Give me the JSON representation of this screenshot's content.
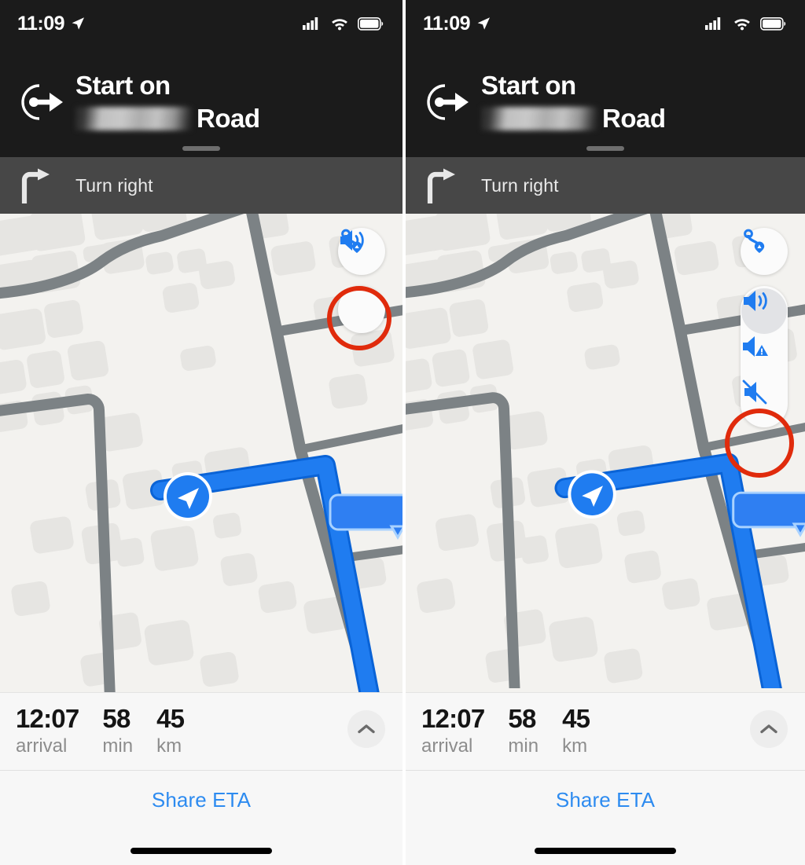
{
  "meta": {
    "app": "Apple Maps",
    "screen": "Turn-by-turn navigation — audio output options",
    "accent_blue": "#1f7cf0",
    "annotation_red": "#e02b0c",
    "map_background": "#f3f2ef",
    "road_gray": "#7c8285",
    "building_gray": "#e6e5e2"
  },
  "panels": [
    {
      "id": "left",
      "status_bar": {
        "time": "11:09",
        "location_icon": "location-arrow-icon",
        "signal_icon": "cellular-signal-icon",
        "wifi_icon": "wifi-icon",
        "battery_icon": "battery-full-icon"
      },
      "banner": {
        "maneuver_icon": "start-on-route-icon",
        "line1": "Start on",
        "redacted_street": "",
        "line2_suffix": "Road",
        "drag_handle": "sheet-drag-handle"
      },
      "next_step": {
        "icon": "turn-right-arrow-icon",
        "label": "Turn right"
      },
      "map_controls": {
        "route_overview_icon": "route-overview-icon",
        "audio_button_icon": "speaker-volume-icon",
        "audio_menu_open": false,
        "highlight": "audio-button"
      },
      "sheet": {
        "stats": [
          {
            "value": "12:07",
            "unit": "arrival"
          },
          {
            "value": "58",
            "unit": "min"
          },
          {
            "value": "45",
            "unit": "km"
          }
        ],
        "expand_icon": "chevron-up-icon",
        "share_label": "Share ETA"
      }
    },
    {
      "id": "right",
      "status_bar": {
        "time": "11:09",
        "location_icon": "location-arrow-icon",
        "signal_icon": "cellular-signal-icon",
        "wifi_icon": "wifi-icon",
        "battery_icon": "battery-full-icon"
      },
      "banner": {
        "maneuver_icon": "start-on-route-icon",
        "line1": "Start on",
        "redacted_street": "",
        "line2_suffix": "Road",
        "drag_handle": "sheet-drag-handle"
      },
      "next_step": {
        "icon": "turn-right-arrow-icon",
        "label": "Turn right"
      },
      "map_controls": {
        "route_overview_icon": "route-overview-icon",
        "audio_menu_open": true,
        "audio_options": [
          {
            "icon": "speaker-volume-icon",
            "name": "volume-full",
            "selected": true
          },
          {
            "icon": "speaker-alerts-only-icon",
            "name": "alerts-only",
            "selected": false
          },
          {
            "icon": "speaker-muted-icon",
            "name": "muted",
            "selected": false
          }
        ],
        "highlight": "muted-option"
      },
      "sheet": {
        "stats": [
          {
            "value": "12:07",
            "unit": "arrival"
          },
          {
            "value": "58",
            "unit": "min"
          },
          {
            "value": "45",
            "unit": "km"
          }
        ],
        "expand_icon": "chevron-up-icon",
        "share_label": "Share ETA"
      }
    }
  ]
}
